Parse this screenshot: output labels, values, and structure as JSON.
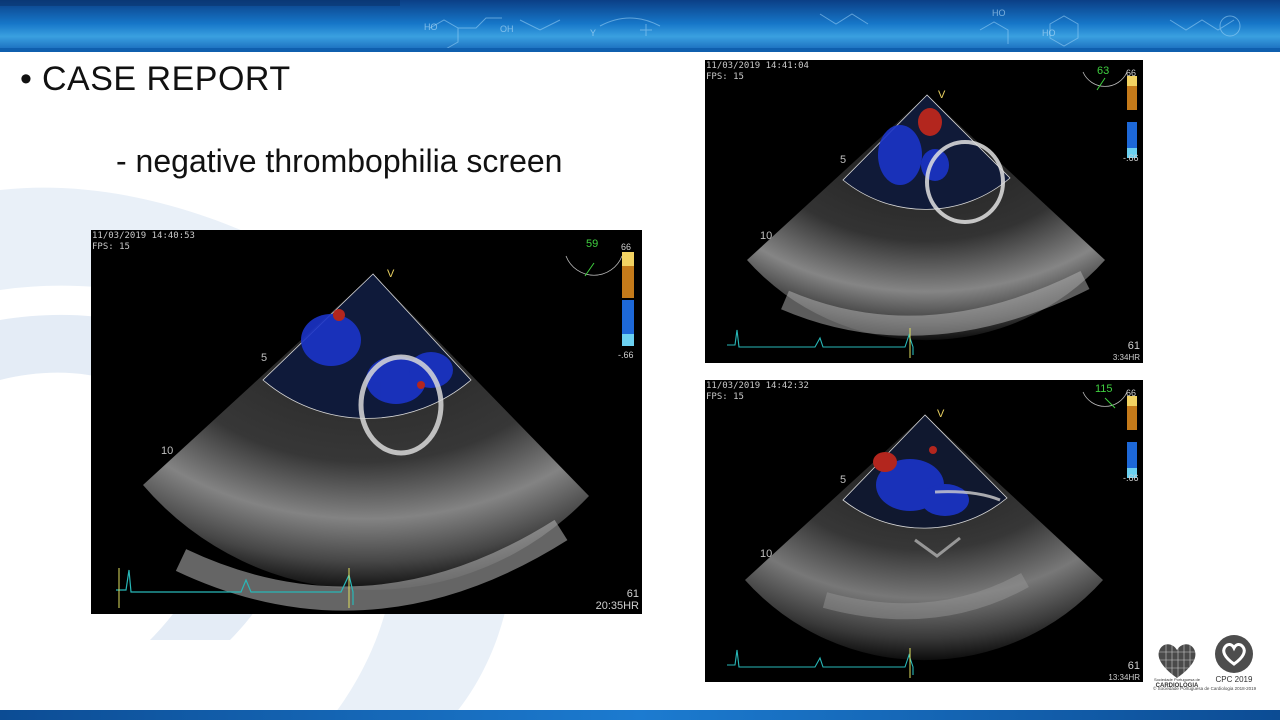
{
  "slide": {
    "bullet_title": "CASE REPORT",
    "sub_text": "- negative thrombophilia screen"
  },
  "echo_panels": [
    {
      "timestamp": "11/03/2019 14:40:53",
      "fps": "FPS: 15",
      "sector_angle": "59",
      "scale_top": "66",
      "scale_bottom": "-.66",
      "depth_5": "5",
      "depth_10": "10",
      "v_marker": "V",
      "hr_value": "61",
      "hr_time": "20:35",
      "hr_unit": "HR"
    },
    {
      "timestamp": "11/03/2019 14:41:04",
      "fps": "FPS: 15",
      "sector_angle": "63",
      "scale_top": "66",
      "scale_bottom": "-.66",
      "depth_5": "5",
      "depth_10": "10",
      "v_marker": "V",
      "hr_value": "61",
      "hr_time": "3:34",
      "hr_unit": "HR"
    },
    {
      "timestamp": "11/03/2019 14:42:32",
      "fps": "FPS: 15",
      "sector_angle": "115",
      "scale_top": "66",
      "scale_bottom": "-.66",
      "depth_5": "5",
      "depth_10": "10",
      "v_marker": "V",
      "hr_value": "61",
      "hr_time": "13:34",
      "hr_unit": "HR"
    }
  ],
  "logos": {
    "spc_name": "CARDIOLOGIA",
    "spc_small": "Sociedade Portuguesa de",
    "cpc_text": "CPC 2019",
    "copyright": "© Sociedade Portuguesa de Cardiologia 2018-2019",
    "spc_icon": "heart-grid-icon",
    "cpc_icon": "heart-ring-icon"
  },
  "colors": {
    "banner_dark": "#0b3f86",
    "banner_light": "#3aa0e0",
    "text": "#111111",
    "cpc_logo": "#4d4d4d"
  }
}
